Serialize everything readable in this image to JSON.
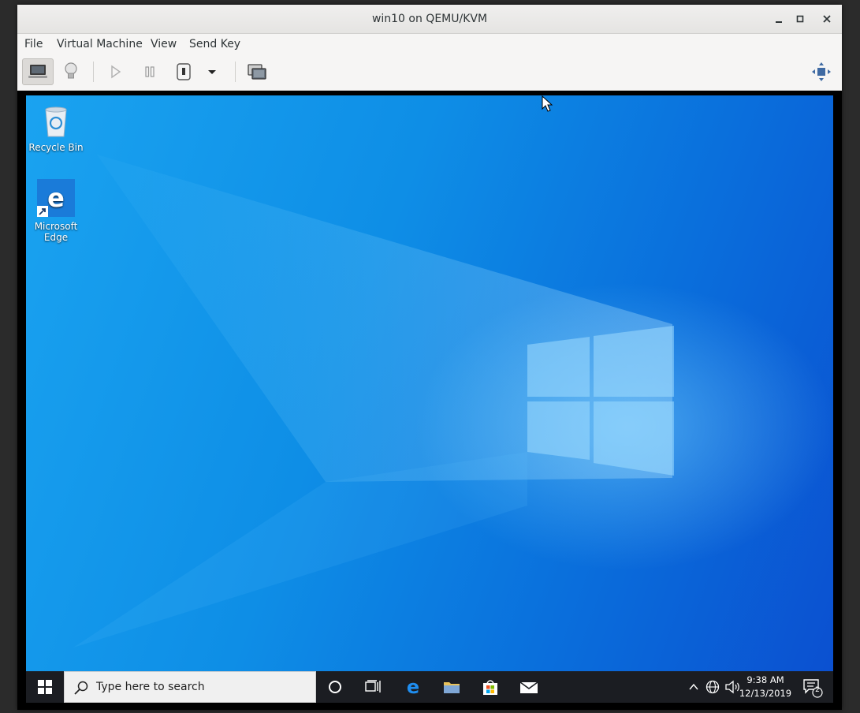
{
  "window": {
    "title": "win10 on QEMU/KVM"
  },
  "menubar": {
    "items": [
      "File",
      "Virtual Machine",
      "View",
      "Send Key"
    ]
  },
  "toolbar": {
    "buttons": [
      "console-view",
      "details-view",
      "run",
      "pause",
      "shutdown",
      "shutdown-menu",
      "snapshots",
      "fullscreen"
    ]
  },
  "desktop": {
    "icons": [
      {
        "label": "Recycle Bin",
        "icon": "recycle-bin-icon"
      },
      {
        "label_line1": "Microsoft",
        "label_line2": "Edge",
        "icon": "edge-icon"
      }
    ]
  },
  "taskbar": {
    "search_placeholder": "Type here to search",
    "time": "9:38 AM",
    "date": "12/13/2019",
    "notification_count": "2"
  },
  "colors": {
    "accent_blue": "#0a78e6",
    "taskbar_bg": "#1b1d22",
    "edge_blue": "#1a7bd9"
  }
}
